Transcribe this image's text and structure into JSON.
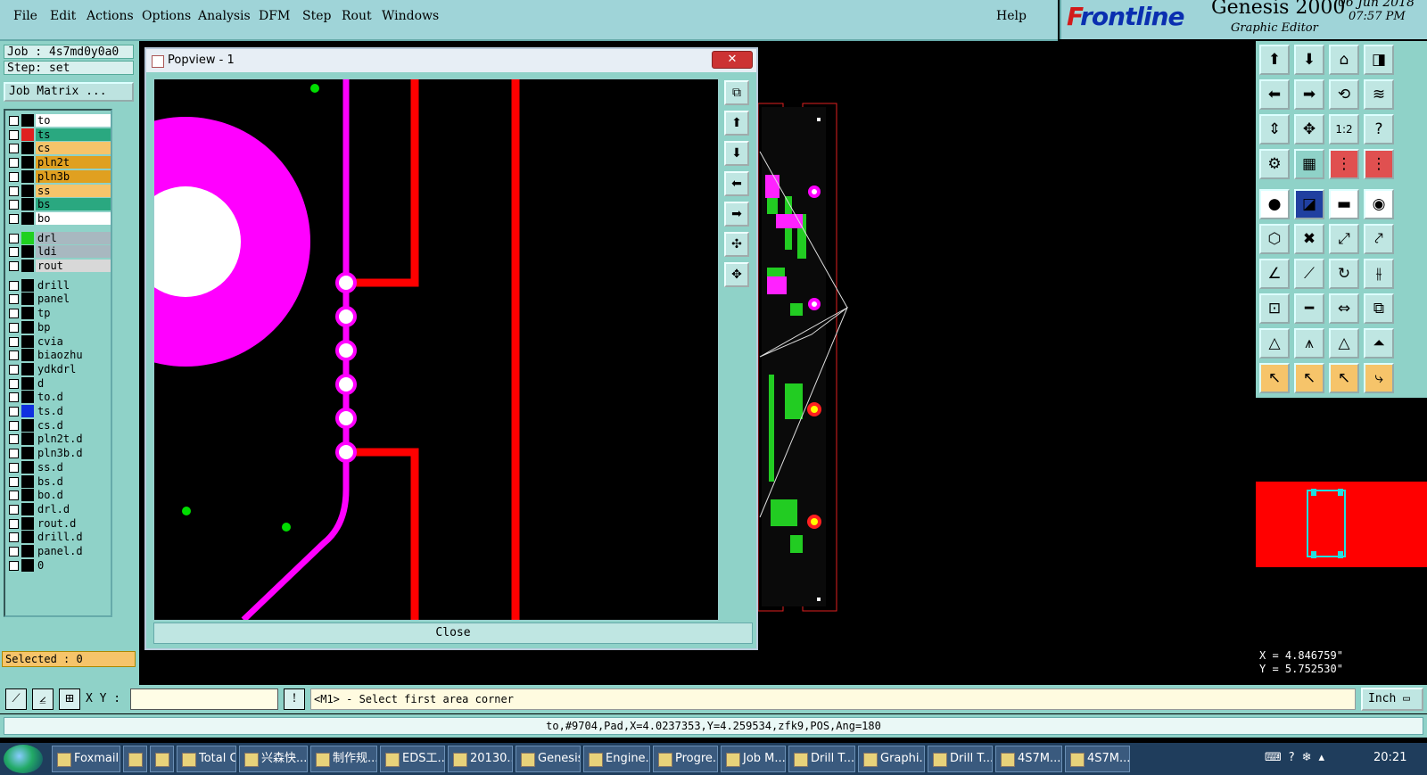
{
  "menu": {
    "items": [
      "File",
      "Edit",
      "Actions",
      "Options",
      "Analysis",
      "DFM",
      "Step",
      "Rout",
      "Windows"
    ],
    "help": "Help"
  },
  "brand": {
    "logo_pre": "F",
    "logo_rest": "rontline",
    "product": "Genesis 2000",
    "subtitle": "Graphic Editor",
    "date": "06 Jun 2018",
    "time": "07:57 PM"
  },
  "left": {
    "job": "Job : 4s7md0y0a0",
    "step": "Step: set",
    "job_matrix": "Job Matrix ...",
    "selected": "Selected : 0",
    "layers": [
      {
        "name": "to",
        "swatch": "#000000",
        "bg": "#ffffff"
      },
      {
        "name": "ts",
        "swatch": "#e02020",
        "bg": "#2aa880"
      },
      {
        "name": "cs",
        "swatch": "#000000",
        "bg": "#f6c46a"
      },
      {
        "name": "pln2t",
        "swatch": "#000000",
        "bg": "#e0a020"
      },
      {
        "name": "pln3b",
        "swatch": "#000000",
        "bg": "#e0a020"
      },
      {
        "name": "ss",
        "swatch": "#000000",
        "bg": "#f6c46a"
      },
      {
        "name": "bs",
        "swatch": "#000000",
        "bg": "#2aa880"
      },
      {
        "name": "bo",
        "swatch": "#000000",
        "bg": "#ffffff"
      },
      {
        "name": "drl",
        "swatch": "#20d020",
        "bg": "#a8b8c0"
      },
      {
        "name": "ldi",
        "swatch": "#000000",
        "bg": "#a8b8c0"
      },
      {
        "name": "rout",
        "swatch": "#000000",
        "bg": "#d8d8d8"
      },
      {
        "name": "drill",
        "swatch": "#000000",
        "bg": "#8fd2c8"
      },
      {
        "name": "panel",
        "swatch": "#000000",
        "bg": "#8fd2c8"
      },
      {
        "name": "tp",
        "swatch": "#000000",
        "bg": "#8fd2c8"
      },
      {
        "name": "bp",
        "swatch": "#000000",
        "bg": "#8fd2c8"
      },
      {
        "name": "cvia",
        "swatch": "#000000",
        "bg": "#8fd2c8"
      },
      {
        "name": "biaozhu",
        "swatch": "#000000",
        "bg": "#8fd2c8"
      },
      {
        "name": "ydkdrl",
        "swatch": "#000000",
        "bg": "#8fd2c8"
      },
      {
        "name": "d",
        "swatch": "#000000",
        "bg": "#8fd2c8"
      },
      {
        "name": "to.d",
        "swatch": "#000000",
        "bg": "#8fd2c8"
      },
      {
        "name": "ts.d",
        "swatch": "#1030e0",
        "bg": "#8fd2c8"
      },
      {
        "name": "cs.d",
        "swatch": "#000000",
        "bg": "#8fd2c8"
      },
      {
        "name": "pln2t.d",
        "swatch": "#000000",
        "bg": "#8fd2c8"
      },
      {
        "name": "pln3b.d",
        "swatch": "#000000",
        "bg": "#8fd2c8"
      },
      {
        "name": "ss.d",
        "swatch": "#000000",
        "bg": "#8fd2c8"
      },
      {
        "name": "bs.d",
        "swatch": "#000000",
        "bg": "#8fd2c8"
      },
      {
        "name": "bo.d",
        "swatch": "#000000",
        "bg": "#8fd2c8"
      },
      {
        "name": "drl.d",
        "swatch": "#000000",
        "bg": "#8fd2c8"
      },
      {
        "name": "rout.d",
        "swatch": "#000000",
        "bg": "#8fd2c8"
      },
      {
        "name": "drill.d",
        "swatch": "#000000",
        "bg": "#8fd2c8"
      },
      {
        "name": "panel.d",
        "swatch": "#000000",
        "bg": "#8fd2c8"
      },
      {
        "name": "0",
        "swatch": "#000000",
        "bg": "#8fd2c8"
      }
    ]
  },
  "popview": {
    "title": "Popview - 1",
    "close_x": "✕",
    "close_label": "Close"
  },
  "coords": {
    "x": "X = 4.846759\"",
    "y": "Y = 5.752530\""
  },
  "command": {
    "xy_label": "X Y :",
    "xy_value": "",
    "prompt": "<M1> - Select first area corner",
    "unit": "Inch"
  },
  "status": "to,#9704,Pad,X=4.0237353,Y=4.259534,zfk9,POS,Ang=180",
  "taskbar": {
    "tasks": [
      "Foxmail",
      "",
      "",
      "Total C...",
      "兴森快...",
      "制作规...",
      "EDS工...",
      "20130...",
      "Genesis",
      "Engine...",
      "Progre...",
      "Job M...",
      "Drill T...",
      "Graphi...",
      "Drill T...",
      "4S7M...",
      "4S7M..."
    ],
    "clock": "20:21"
  }
}
